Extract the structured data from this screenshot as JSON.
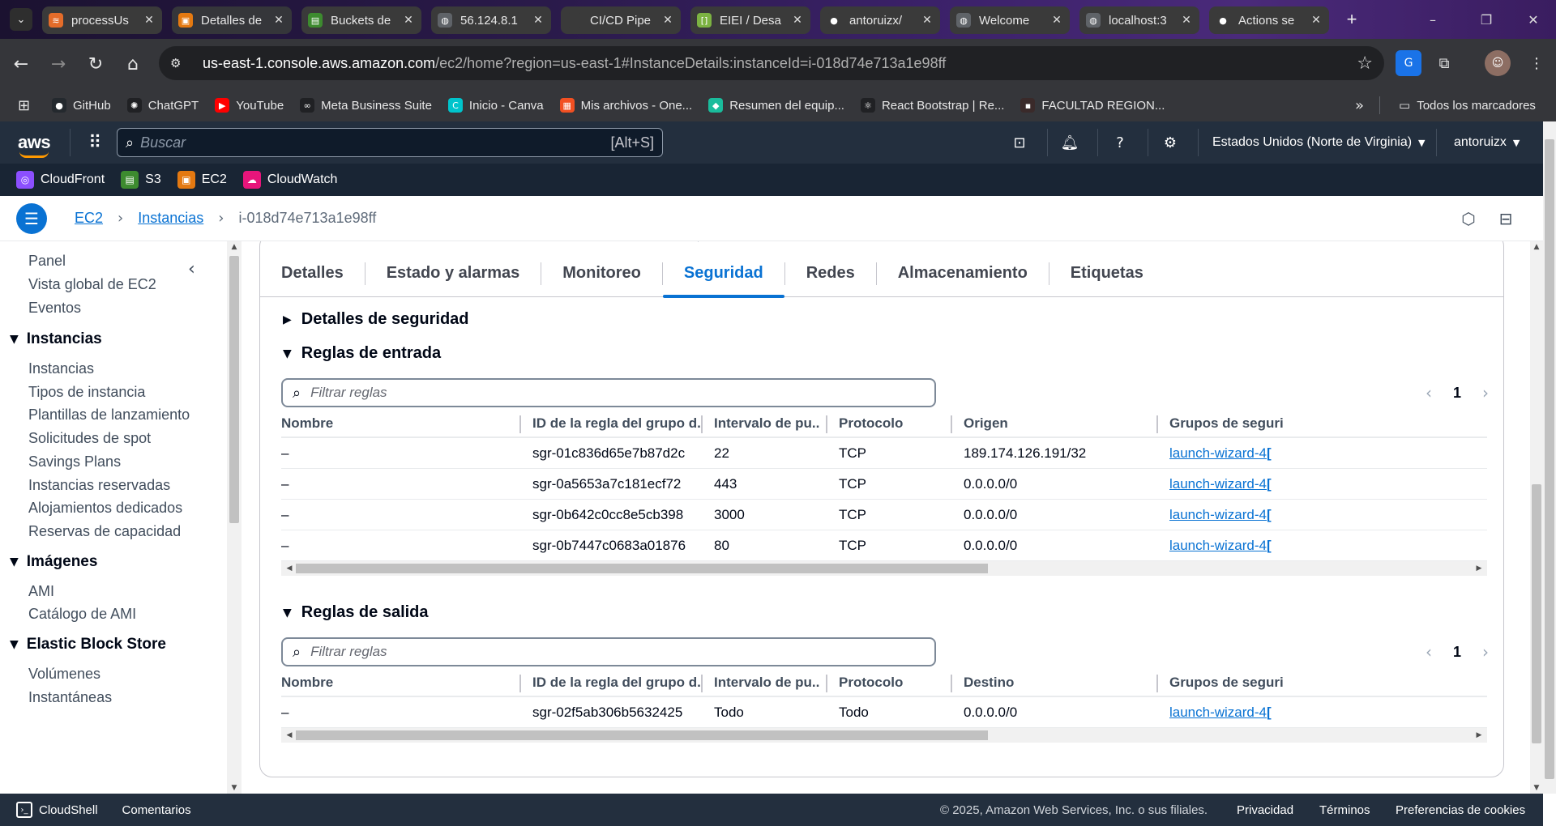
{
  "browser": {
    "tabs": [
      {
        "title": "processUs",
        "icon_color": "#e46c2a",
        "icon_glyph": "≋"
      },
      {
        "title": "Detalles de",
        "icon_color": "#e47911",
        "icon_glyph": "▣"
      },
      {
        "title": "Buckets de",
        "icon_color": "#3d8b2f",
        "icon_glyph": "▤"
      },
      {
        "title": "56.124.8.1",
        "icon_color": "#5f6368",
        "icon_glyph": "◍"
      },
      {
        "title": "CI/CD Pipe",
        "icon_color": "#3a3a3a",
        "icon_glyph": ""
      },
      {
        "title": "EIEI / Desa",
        "icon_color": "#7cb342",
        "icon_glyph": "[]"
      },
      {
        "title": "antoruizx/",
        "icon_color": "#3a3a3a",
        "icon_glyph": "●"
      },
      {
        "title": "Welcome",
        "icon_color": "#5f6368",
        "icon_glyph": "◍"
      },
      {
        "title": "localhost:3",
        "icon_color": "#5f6368",
        "icon_glyph": "◍"
      },
      {
        "title": "Actions se",
        "icon_color": "#3a3a3a",
        "icon_glyph": "●"
      }
    ],
    "active_tab_index": 1,
    "url_host": "us-east-1.console.aws.amazon.com",
    "url_path": "/ec2/home?region=us-east-1#InstanceDetails:instanceId=i-018d74e713a1e98ff",
    "bookmarks": [
      {
        "label": "GitHub",
        "color": "#24292e",
        "glyph": "●"
      },
      {
        "label": "ChatGPT",
        "color": "#202124",
        "glyph": "✺"
      },
      {
        "label": "YouTube",
        "color": "#ff0000",
        "glyph": "▶"
      },
      {
        "label": "Meta Business Suite",
        "color": "#202124",
        "glyph": "∞"
      },
      {
        "label": "Inicio - Canva",
        "color": "#00c4cc",
        "glyph": "C"
      },
      {
        "label": "Mis archivos - One...",
        "color": "#f25022",
        "glyph": "▦"
      },
      {
        "label": "Resumen del equip...",
        "color": "#1abc9c",
        "glyph": "◆"
      },
      {
        "label": "React Bootstrap | Re...",
        "color": "#202124",
        "glyph": "⚛"
      },
      {
        "label": "FACULTAD REGION...",
        "color": "#3a2a2a",
        "glyph": "▪"
      }
    ],
    "all_bookmarks": "Todos los marcadores"
  },
  "aws": {
    "logo": "aws",
    "search_placeholder": "Buscar",
    "search_shortcut": "[Alt+S]",
    "region": "Estados Unidos (Norte de Virginia)",
    "user": "antoruizx",
    "favorites": [
      {
        "label": "CloudFront",
        "color": "#8c4fff",
        "glyph": "◎"
      },
      {
        "label": "S3",
        "color": "#3d8b2f",
        "glyph": "▤"
      },
      {
        "label": "EC2",
        "color": "#e47911",
        "glyph": "▣"
      },
      {
        "label": "CloudWatch",
        "color": "#e7157b",
        "glyph": "☁"
      }
    ],
    "breadcrumb": [
      "EC2",
      "Instancias",
      "i-018d74e713a1e98ff"
    ]
  },
  "nav": {
    "top_links": [
      "Panel",
      "Vista global de EC2",
      "Eventos"
    ],
    "sections": [
      {
        "title": "Instancias",
        "items": [
          "Instancias",
          "Tipos de instancia",
          "Plantillas de lanzamiento",
          "Solicitudes de spot",
          "Savings Plans",
          "Instancias reservadas",
          "Alojamientos dedicados",
          "Reservas de capacidad"
        ]
      },
      {
        "title": "Imágenes",
        "items": [
          "AMI",
          "Catálogo de AMI"
        ]
      },
      {
        "title": "Elastic Block Store",
        "items": [
          "Volúmenes",
          "Instantáneas"
        ]
      }
    ]
  },
  "detail_tabs": [
    "Detalles",
    "Estado y alarmas",
    "Monitoreo",
    "Seguridad",
    "Redes",
    "Almacenamiento",
    "Etiquetas"
  ],
  "selected_tab": "Seguridad",
  "security": {
    "details_title": "Detalles de seguridad",
    "inbound": {
      "title": "Reglas de entrada",
      "filter_placeholder": "Filtrar reglas",
      "page": "1",
      "columns": [
        "Nombre",
        "ID de la regla del grupo d...",
        "Intervalo de pu...",
        "Protocolo",
        "Origen",
        "Grupos de seguri"
      ],
      "rows": [
        [
          "–",
          "sgr-01c836d65e7b87d2c",
          "22",
          "TCP",
          "189.174.126.191/32",
          "launch-wizard-4"
        ],
        [
          "–",
          "sgr-0a5653a7c181ecf72",
          "443",
          "TCP",
          "0.0.0.0/0",
          "launch-wizard-4"
        ],
        [
          "–",
          "sgr-0b642c0cc8e5cb398",
          "3000",
          "TCP",
          "0.0.0.0/0",
          "launch-wizard-4"
        ],
        [
          "–",
          "sgr-0b7447c0683a01876",
          "80",
          "TCP",
          "0.0.0.0/0",
          "launch-wizard-4"
        ]
      ]
    },
    "outbound": {
      "title": "Reglas de salida",
      "filter_placeholder": "Filtrar reglas",
      "page": "1",
      "columns": [
        "Nombre",
        "ID de la regla del grupo d...",
        "Intervalo de pu...",
        "Protocolo",
        "Destino",
        "Grupos de seguri"
      ],
      "rows": [
        [
          "–",
          "sgr-02f5ab306b5632425",
          "Todo",
          "Todo",
          "0.0.0.0/0",
          "launch-wizard-4"
        ]
      ]
    }
  },
  "footer": {
    "cloudshell": "CloudShell",
    "feedback": "Comentarios",
    "copyright": "© 2025, Amazon Web Services, Inc. o sus filiales.",
    "links": [
      "Privacidad",
      "Términos",
      "Preferencias de cookies"
    ]
  }
}
